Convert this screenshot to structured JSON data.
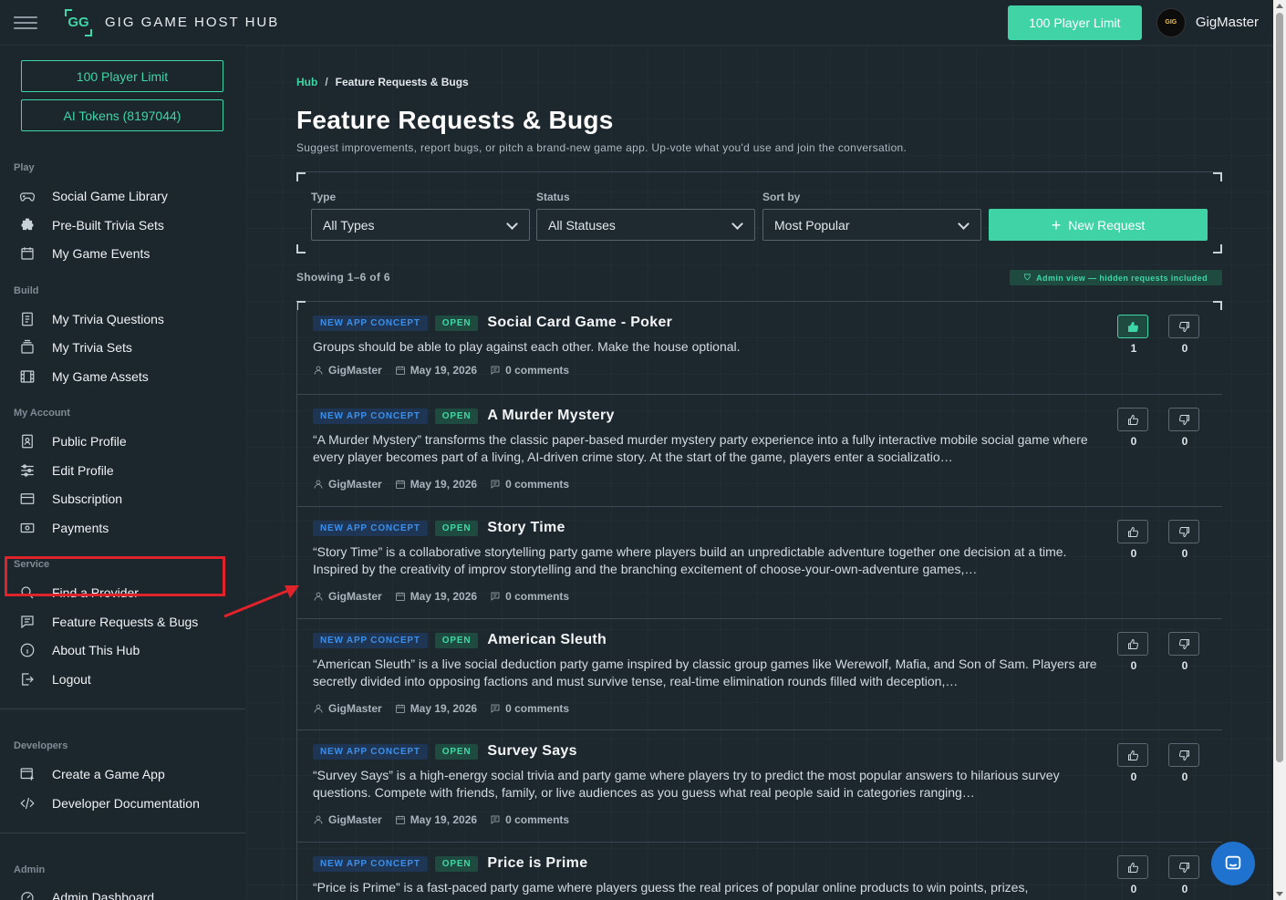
{
  "app": {
    "brand": "GIG GAME HOST HUB",
    "logo_text": "GG"
  },
  "topbar": {
    "limit_button": "100 Player Limit",
    "avatar_text": "GIG",
    "username": "GigMaster"
  },
  "sidebar": {
    "buttons": {
      "player_limit": "100 Player Limit",
      "ai_tokens": "AI Tokens (8197044)"
    },
    "sections": {
      "play": "Play",
      "build": "Build",
      "account": "My Account",
      "service": "Service",
      "developers": "Developers",
      "admin": "Admin"
    },
    "items": {
      "social_game_library": "Social Game Library",
      "pre_built_trivia_sets": "Pre-Built Trivia Sets",
      "my_game_events": "My Game Events",
      "my_trivia_questions": "My Trivia Questions",
      "my_trivia_sets": "My Trivia Sets",
      "my_game_assets": "My Game Assets",
      "public_profile": "Public Profile",
      "edit_profile": "Edit Profile",
      "subscription": "Subscription",
      "payments": "Payments",
      "find_provider": "Find a Provider",
      "feature_requests": "Feature Requests & Bugs",
      "about_hub": "About This Hub",
      "logout": "Logout",
      "create_game_app": "Create a Game App",
      "developer_docs": "Developer Documentation",
      "admin_dashboard": "Admin Dashboard"
    }
  },
  "breadcrumb": {
    "hub": "Hub",
    "sep": "/",
    "current": "Feature Requests & Bugs"
  },
  "page": {
    "title": "Feature Requests & Bugs",
    "subtitle": "Suggest improvements, report bugs, or pitch a brand-new game app. Up-vote what you'd use and join the conversation."
  },
  "filters": {
    "type_label": "Type",
    "type_value": "All Types",
    "status_label": "Status",
    "status_value": "All Statuses",
    "sort_label": "Sort by",
    "sort_value": "Most Popular",
    "new_request": "New Request"
  },
  "showing": "Showing 1–6 of 6",
  "admin_badge": "Admin view — hidden requests included",
  "requests": [
    {
      "type": "NEW APP CONCEPT",
      "status": "OPEN",
      "title": "Social Card Game - Poker",
      "desc": "Groups should be able to play against each other. Make the house optional.",
      "author": "GigMaster",
      "date": "May 19, 2026",
      "comments": "0 comments",
      "up": "1",
      "down": "0"
    },
    {
      "type": "NEW APP CONCEPT",
      "status": "OPEN",
      "title": "A Murder Mystery",
      "desc": "“A Murder Mystery” transforms the classic paper-based murder mystery party experience into a fully interactive mobile social game where every player becomes part of a living, AI-driven crime story. At the start of the game, players enter a socializatio…",
      "author": "GigMaster",
      "date": "May 19, 2026",
      "comments": "0 comments",
      "up": "0",
      "down": "0"
    },
    {
      "type": "NEW APP CONCEPT",
      "status": "OPEN",
      "title": "Story Time",
      "desc": "“Story Time” is a collaborative storytelling party game where players build an unpredictable adventure together one decision at a time. Inspired by the creativity of improv storytelling and the branching excitement of choose-your-own-adventure games,…",
      "author": "GigMaster",
      "date": "May 19, 2026",
      "comments": "0 comments",
      "up": "0",
      "down": "0"
    },
    {
      "type": "NEW APP CONCEPT",
      "status": "OPEN",
      "title": "American Sleuth",
      "desc": "“American Sleuth” is a live social deduction party game inspired by classic group games like Werewolf, Mafia, and Son of Sam. Players are secretly divided into opposing factions and must survive tense, real-time elimination rounds filled with deception,…",
      "author": "GigMaster",
      "date": "May 19, 2026",
      "comments": "0 comments",
      "up": "0",
      "down": "0"
    },
    {
      "type": "NEW APP CONCEPT",
      "status": "OPEN",
      "title": "Survey Says",
      "desc": "“Survey Says” is a high-energy social trivia and party game where players try to predict the most popular answers to hilarious survey questions. Compete with friends, family, or live audiences as you guess what real people said in categories ranging…",
      "author": "GigMaster",
      "date": "May 19, 2026",
      "comments": "0 comments",
      "up": "0",
      "down": "0"
    },
    {
      "type": "NEW APP CONCEPT",
      "status": "OPEN",
      "title": "Price is Prime",
      "desc": "“Price is Prime” is a fast-paced party game where players guess the real prices of popular online products to win points, prizes,",
      "author": "GigMaster",
      "date": "May 19, 2026",
      "comments": "0 comments",
      "up": "0",
      "down": "0"
    }
  ],
  "colors": {
    "accent": "#3fd3a5",
    "tag_blue": "#3d8fe8",
    "highlight": "#e0232b",
    "chat": "#1f73cf"
  }
}
